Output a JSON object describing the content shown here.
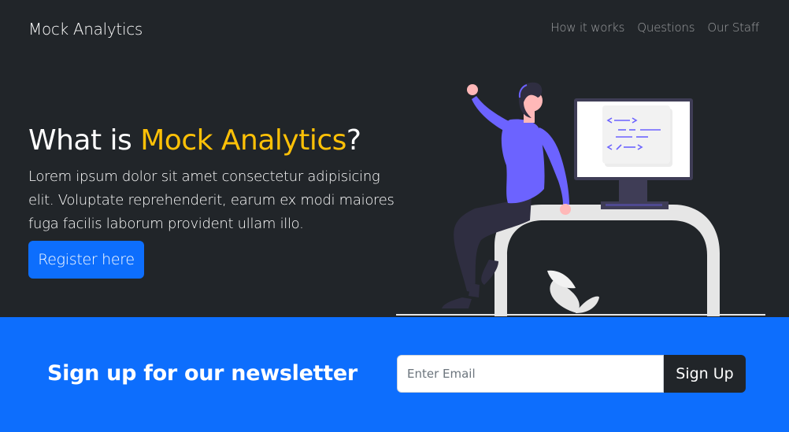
{
  "navbar": {
    "brand": "Mock Analytics",
    "links": [
      "How it works",
      "Questions",
      "Our Staff"
    ]
  },
  "hero": {
    "title_prefix": "What is ",
    "title_accent": "Mock Analytics",
    "title_suffix": "?",
    "text": "Lorem ipsum dolor sit amet consectetur adipisicing elit. Voluptate reprehenderit, earum ex modi maiores fuga facilis laborum provident ullam illo.",
    "button": "Register here"
  },
  "newsletter": {
    "title": "Sign up for our newsletter",
    "email_placeholder": "Enter Email",
    "button": "Sign Up"
  },
  "colors": {
    "dark": "#212529",
    "accent": "#ffc107",
    "primary": "#0d6efd",
    "illustration_purple": "#6c63ff"
  },
  "icons": {
    "illustration": "woman-at-desk-illustration",
    "code": "code-icon"
  }
}
